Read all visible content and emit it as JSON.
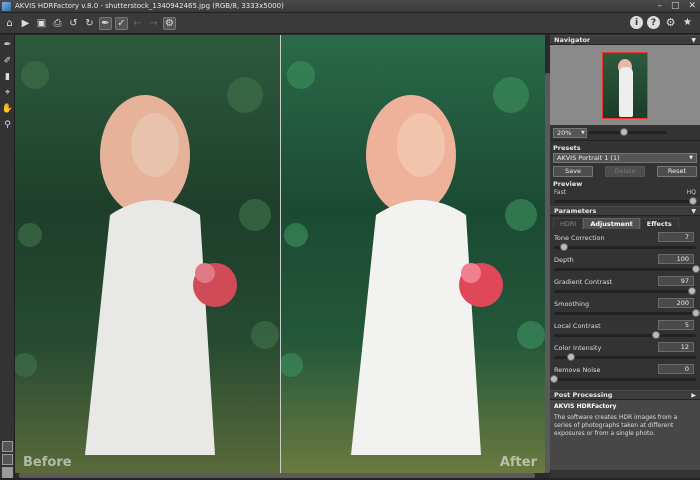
{
  "window": {
    "title": "AKVIS HDRFactory v.8.0 - shutterstock_1340942465.jpg (RGB/8, 3333x5000)",
    "controls": [
      "–",
      "□",
      "✕"
    ]
  },
  "toolbar": {
    "left_icons": [
      "home-icon",
      "open-icon",
      "save-icon",
      "print-icon",
      "undo-icon",
      "redo-icon",
      "brush-mode-icon",
      "compare-mode-icon",
      "back-icon",
      "forward-icon",
      "batch-icon"
    ],
    "right_icons": [
      "info-icon",
      "help-icon",
      "settings-icon",
      "notifications-icon"
    ]
  },
  "left_tools": [
    "eyedropper-icon",
    "brush-icon",
    "eraser-icon",
    "crop-icon",
    "hand-icon",
    "zoom-icon"
  ],
  "canvas": {
    "before_label": "Before",
    "after_label": "After"
  },
  "panel": {
    "navigator": {
      "title": "Navigator",
      "zoom": "20%",
      "zoom_level": 0.45
    },
    "presets": {
      "title": "Presets",
      "selected": "AKVIS Portrait 1 (1)",
      "save": "Save",
      "delete": "Delete",
      "reset": "Reset"
    },
    "preview": {
      "title": "Preview",
      "fast": "Fast",
      "hq": "HQ"
    },
    "parameters": {
      "title": "Parameters",
      "tabs": [
        "HDRI",
        "Adjustment",
        "Effects"
      ],
      "active_tab": "Adjustment",
      "items": [
        {
          "label": "Tone Correction",
          "value": "7",
          "level": 0.07
        },
        {
          "label": "Depth",
          "value": "100",
          "level": 1.0
        },
        {
          "label": "Gradient Contrast",
          "value": "97",
          "level": 0.97
        },
        {
          "label": "Smoothing",
          "value": "200",
          "level": 1.0
        },
        {
          "label": "Local Contrast",
          "value": "5",
          "level": 0.72
        },
        {
          "label": "Color Intensity",
          "value": "12",
          "level": 0.12
        },
        {
          "label": "Remove Noise",
          "value": "0",
          "level": 0.0
        }
      ]
    },
    "post_processing": {
      "title": "Post Processing"
    },
    "description": {
      "title": "AKVIS HDRFactory",
      "text": "The software creates HDR images from a series of photographs taken at different exposures or from a single photo."
    }
  }
}
